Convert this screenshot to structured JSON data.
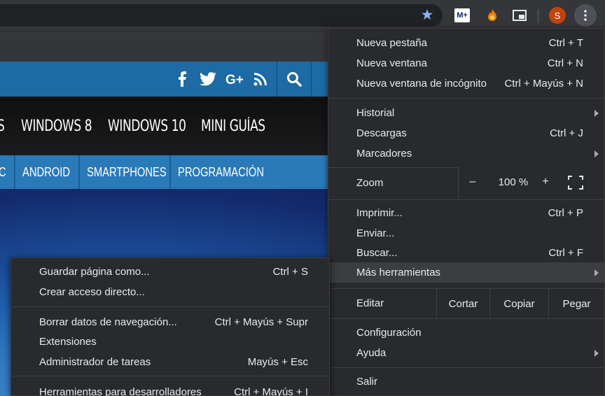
{
  "toolbar": {
    "extension_m_label": "M+",
    "avatar_initial": "S",
    "colors": {
      "star": "#8ab4f8",
      "avatar": "#c1440e"
    }
  },
  "site": {
    "main_nav": [
      "S",
      "WINDOWS 8",
      "WINDOWS 10",
      "MINI GUÍAS"
    ],
    "sub_nav": [
      "C",
      "ANDROID",
      "SMARTPHONES",
      "PROGRAMACIÓN"
    ],
    "social_icons": [
      "facebook-icon",
      "twitter-icon",
      "google-plus-icon",
      "rss-icon"
    ]
  },
  "menu": {
    "new_tab": {
      "label": "Nueva pestaña",
      "shortcut": "Ctrl + T"
    },
    "new_window": {
      "label": "Nueva ventana",
      "shortcut": "Ctrl + N"
    },
    "incognito": {
      "label": "Nueva ventana de incógnito",
      "shortcut": "Ctrl + Mayús + N"
    },
    "history": {
      "label": "Historial"
    },
    "downloads": {
      "label": "Descargas",
      "shortcut": "Ctrl + J"
    },
    "bookmarks": {
      "label": "Marcadores"
    },
    "zoom": {
      "label": "Zoom",
      "minus": "–",
      "value": "100 %",
      "plus": "+"
    },
    "print": {
      "label": "Imprimir...",
      "shortcut": "Ctrl + P"
    },
    "cast": {
      "label": "Enviar..."
    },
    "find": {
      "label": "Buscar...",
      "shortcut": "Ctrl + F"
    },
    "more_tools": {
      "label": "Más herramientas"
    },
    "edit": {
      "label": "Editar",
      "cut": "Cortar",
      "copy": "Copiar",
      "paste": "Pegar"
    },
    "settings": {
      "label": "Configuración"
    },
    "help": {
      "label": "Ayuda"
    },
    "exit": {
      "label": "Salir"
    }
  },
  "submenu": {
    "save_page": {
      "label": "Guardar página como...",
      "shortcut": "Ctrl + S"
    },
    "create_shortcut": {
      "label": "Crear acceso directo..."
    },
    "clear_data": {
      "label": "Borrar datos de navegación...",
      "shortcut": "Ctrl + Mayús + Supr"
    },
    "extensions": {
      "label": "Extensiones"
    },
    "task_manager": {
      "label": "Administrador de tareas",
      "shortcut": "Mayús + Esc"
    },
    "dev_tools": {
      "label": "Herramientas para desarrolladores",
      "shortcut": "Ctrl + Mayús + I"
    }
  }
}
